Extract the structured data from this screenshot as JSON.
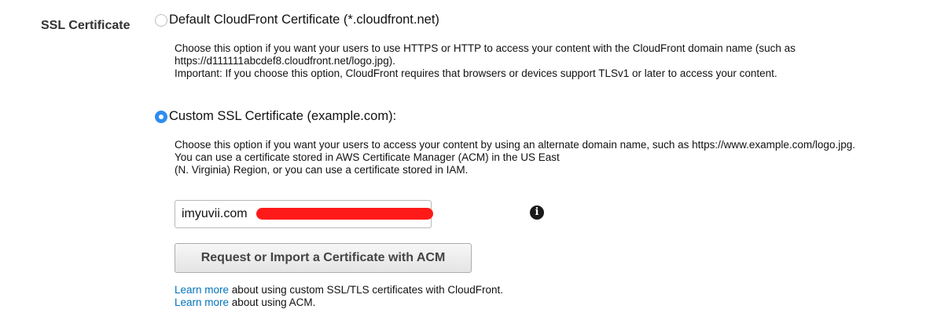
{
  "ssl": {
    "label": "SSL Certificate",
    "default_option": {
      "label": "Default CloudFront Certificate (*.cloudfront.net)",
      "selected": false,
      "description": [
        "Choose this option if you want your users to use HTTPS or HTTP to access your content with the CloudFront domain name (such as",
        "https://d111111abcdef8.cloudfront.net/logo.jpg).",
        "Important: If you choose this option, CloudFront requires that browsers or devices support TLSv1 or later to access your content."
      ]
    },
    "custom_option": {
      "label": "Custom SSL Certificate (example.com):",
      "selected": true,
      "description": [
        "Choose this option if you want your users to access your content by using an alternate domain name, such as https://www.example.com/logo.jpg.",
        "You can use a certificate stored in AWS Certificate Manager (ACM) in the US East",
        "(N. Virginia) Region, or you can use a certificate stored in IAM."
      ]
    },
    "certificate_field": {
      "value": "imyuvii.com"
    },
    "info_icon": "info-circle-icon",
    "acm_button": "Request or Import a Certificate with ACM",
    "links": [
      {
        "link_text": "Learn more",
        "rest": " about using custom SSL/TLS certificates with CloudFront."
      },
      {
        "link_text": "Learn more",
        "rest": " about using ACM."
      }
    ]
  },
  "colors": {
    "radio_selected": "#2e8cf0",
    "link": "#0073bb",
    "redaction": "#ff1a1a"
  }
}
